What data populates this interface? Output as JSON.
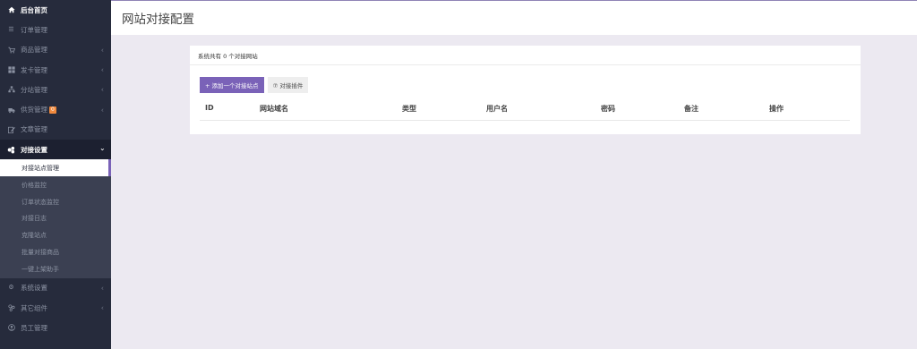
{
  "sidebar": {
    "top": [
      {
        "label": "后台首页",
        "icon": "home-icon"
      },
      {
        "label": "订单管理",
        "icon": "list-icon"
      },
      {
        "label": "商品管理",
        "icon": "cart-icon"
      },
      {
        "label": "发卡管理",
        "icon": "grid-icon"
      },
      {
        "label": "分站管理",
        "icon": "sitemap-icon"
      },
      {
        "label": "供货管理",
        "icon": "truck-icon",
        "badge": "0"
      },
      {
        "label": "文章管理",
        "icon": "edit-icon"
      },
      {
        "label": "对接设置",
        "icon": "link-icon"
      }
    ],
    "sub": [
      {
        "label": "对接站点管理"
      },
      {
        "label": "价格监控"
      },
      {
        "label": "订单状态监控"
      },
      {
        "label": "对接日志"
      },
      {
        "label": "克隆站点"
      },
      {
        "label": "批量对接商品"
      },
      {
        "label": "一键上架助手"
      }
    ],
    "bottom": [
      {
        "label": "系统设置",
        "icon": "gear-icon"
      },
      {
        "label": "其它组件",
        "icon": "puzzle-icon"
      },
      {
        "label": "员工管理",
        "icon": "user-icon"
      }
    ]
  },
  "header": {
    "title": "网站对接配置"
  },
  "panel": {
    "summary": "系统共有 0 个对接网站",
    "add_button": "+ 添加一个对接站点",
    "plugin_button": "⑦ 对接插件",
    "columns": [
      "ID",
      "网站域名",
      "类型",
      "用户名",
      "密码",
      "备注",
      "操作"
    ]
  },
  "colors": {
    "sidebar_bg": "#262b3c",
    "accent": "#7a62b8",
    "badge": "#f0893d",
    "page_bg": "#ece9f1"
  }
}
